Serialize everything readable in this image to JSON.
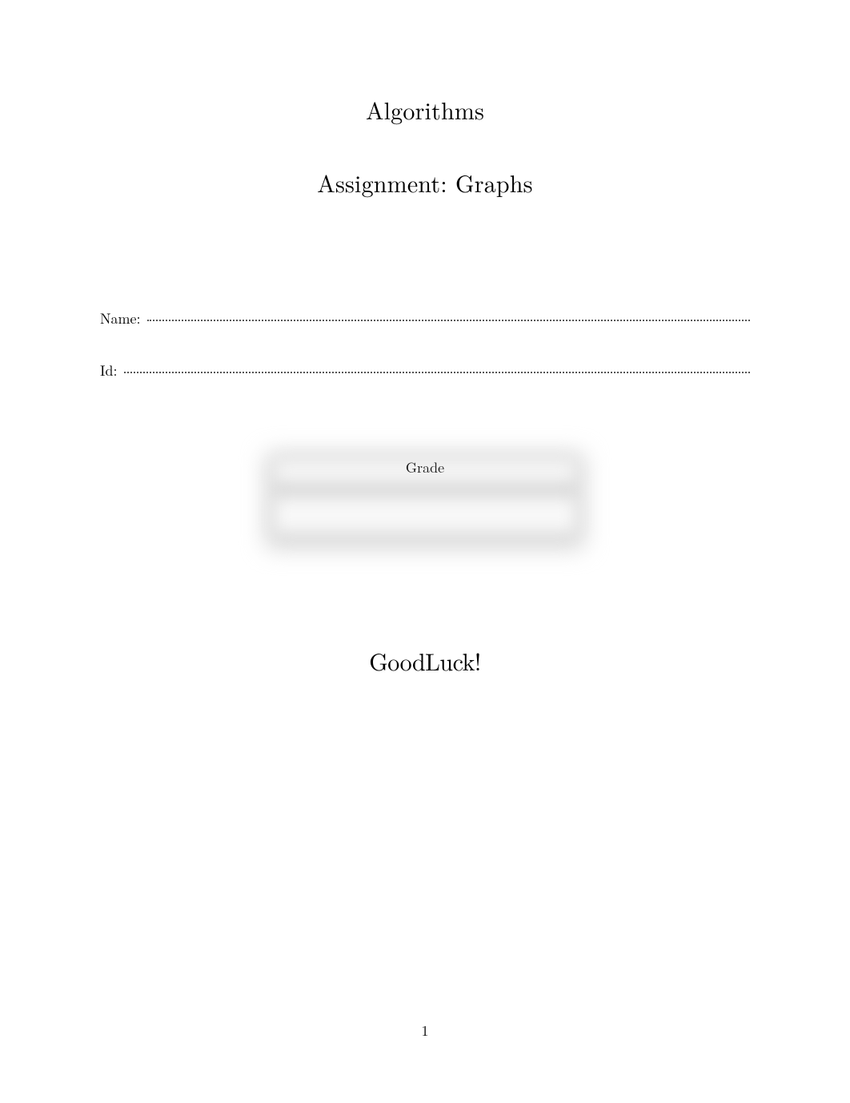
{
  "header": {
    "title": "Algorithms",
    "subtitle": "Assignment: Graphs"
  },
  "fields": {
    "name_label": "Name:",
    "id_label": "Id:"
  },
  "grade": {
    "label": "Grade"
  },
  "footer": {
    "message": "GoodLuck!",
    "page_number": "1"
  }
}
